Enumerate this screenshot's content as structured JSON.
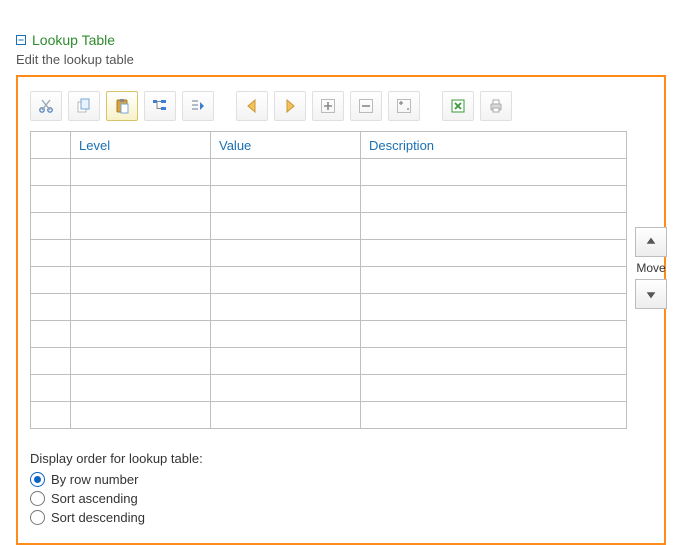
{
  "header": {
    "title": "Lookup Table",
    "subtitle": "Edit the lookup table"
  },
  "toolbar": {
    "icons": [
      "cut",
      "copy",
      "paste",
      "tree",
      "indent",
      "left",
      "right",
      "plus",
      "minus",
      "plus-mini",
      "excel",
      "print"
    ]
  },
  "grid": {
    "columns": [
      "",
      "Level",
      "Value",
      "Description"
    ],
    "row_count": 10
  },
  "move": {
    "label": "Move"
  },
  "options": {
    "title": "Display order for lookup table:",
    "choices": [
      {
        "label": "By row number",
        "checked": true
      },
      {
        "label": "Sort ascending",
        "checked": false
      },
      {
        "label": "Sort descending",
        "checked": false
      }
    ]
  }
}
